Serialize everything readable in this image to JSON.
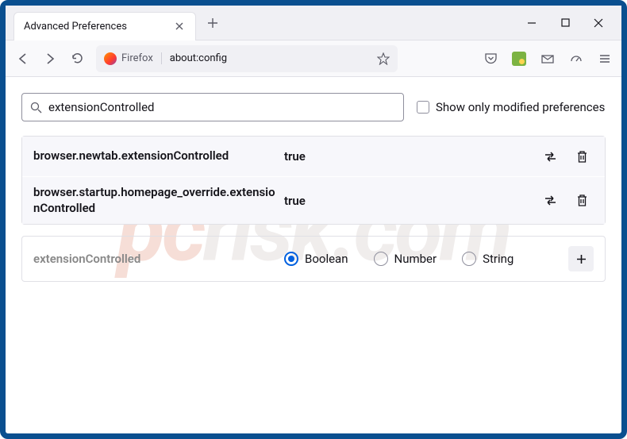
{
  "window": {
    "tab_title": "Advanced Preferences"
  },
  "urlbar": {
    "identity_label": "Firefox",
    "url": "about:config"
  },
  "search": {
    "value": "extensionControlled",
    "checkbox_label": "Show only modified preferences"
  },
  "prefs": [
    {
      "name": "browser.newtab.extensionControlled",
      "value": "true"
    },
    {
      "name": "browser.startup.homepage_override.extensionControlled",
      "value": "true"
    }
  ],
  "new_pref": {
    "name": "extensionControlled",
    "types": [
      "Boolean",
      "Number",
      "String"
    ],
    "selected": "Boolean"
  },
  "watermark": {
    "left": "pc",
    "right": "risk.com"
  }
}
